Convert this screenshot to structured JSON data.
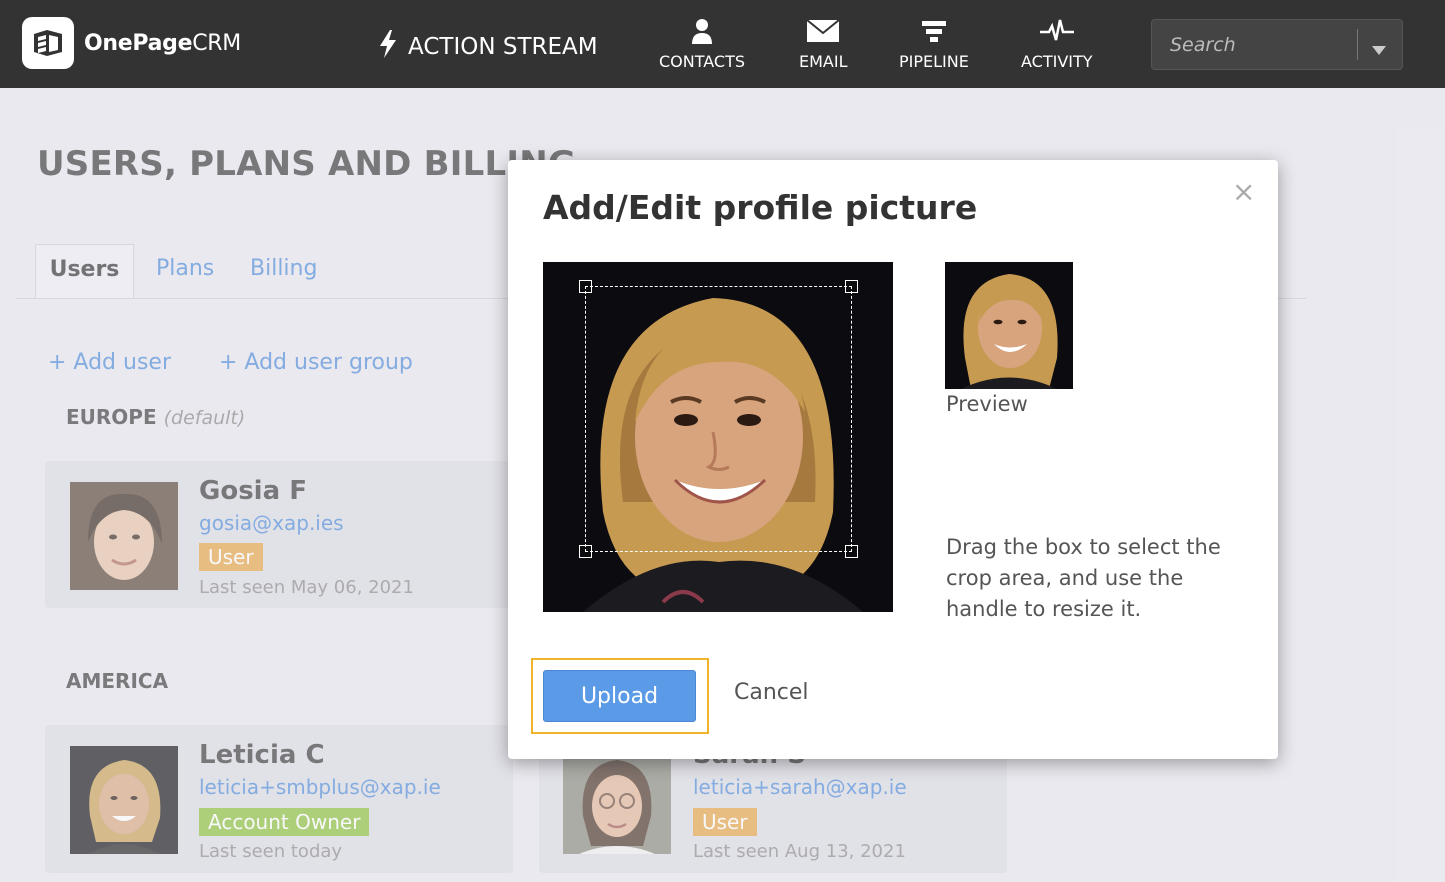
{
  "app": {
    "brand": "OnePage",
    "brand_suffix": "CRM"
  },
  "topnav": {
    "action_stream": "ACTION STREAM",
    "items": [
      {
        "label": "CONTACTS",
        "icon": "person-icon"
      },
      {
        "label": "EMAIL",
        "icon": "envelope-icon"
      },
      {
        "label": "PIPELINE",
        "icon": "funnel-icon"
      },
      {
        "label": "ACTIVITY",
        "icon": "pulse-icon"
      }
    ],
    "search_placeholder": "Search"
  },
  "page": {
    "title": "USERS, PLANS AND BILLING",
    "tabs": [
      {
        "label": "Users",
        "active": true
      },
      {
        "label": "Plans",
        "active": false
      },
      {
        "label": "Billing",
        "active": false
      }
    ],
    "add_user": "+ Add user",
    "add_user_group": "+ Add user group"
  },
  "groups": [
    {
      "name": "EUROPE",
      "suffix": "(default)",
      "users": [
        {
          "name": "Gosia F",
          "email": "gosia@xap.ies",
          "role": "User",
          "last_seen": "Last seen May 06, 2021"
        }
      ]
    },
    {
      "name": "AMERICA",
      "suffix": "",
      "users": [
        {
          "name": "Leticia C",
          "email": "leticia+smbplus@xap.ie",
          "role": "Account Owner",
          "last_seen": "Last seen today"
        },
        {
          "name": "Sarah S",
          "email": "leticia+sarah@xap.ie",
          "role": "User",
          "last_seen": "Last seen Aug 13, 2021"
        }
      ]
    }
  ],
  "modal": {
    "title": "Add/Edit profile picture",
    "close": "×",
    "preview_label": "Preview",
    "help_text": "Drag the box to select the crop area, and use the handle to resize it.",
    "upload": "Upload",
    "cancel": "Cancel"
  },
  "colors": {
    "topbar": "#333333",
    "link": "#4d8ad8",
    "role_user": "#e6a545",
    "role_owner": "#8dc13b",
    "upload_button": "#5a9ae6",
    "highlight": "#f0b429"
  }
}
